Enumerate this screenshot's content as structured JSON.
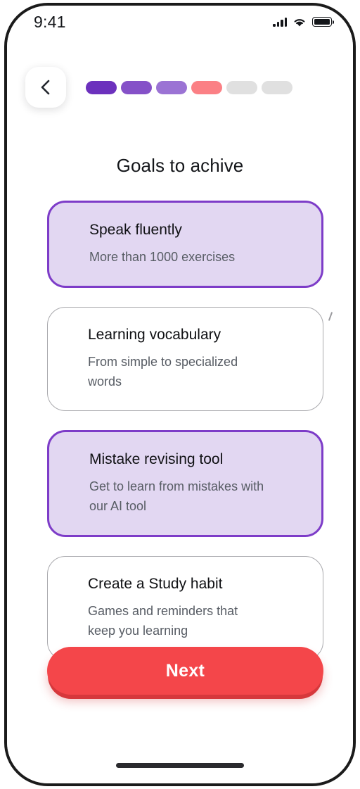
{
  "status_bar": {
    "time": "9:41",
    "icons": {
      "signal": "signal-bars-icon",
      "wifi": "wifi-icon",
      "battery": "battery-icon"
    }
  },
  "header": {
    "back_icon": "chevron-left-icon",
    "progress": {
      "total_steps": 6,
      "current_step": 4,
      "segments": [
        {
          "state": "complete",
          "color": "#6c31bd"
        },
        {
          "state": "complete",
          "color": "#8551c8"
        },
        {
          "state": "complete",
          "color": "#9b73d4"
        },
        {
          "state": "current",
          "color": "#fb8085"
        },
        {
          "state": "upcoming",
          "color": "#e0e0e0"
        },
        {
          "state": "upcoming",
          "color": "#e0e0e0"
        }
      ]
    }
  },
  "main": {
    "title": "Goals to achive",
    "goals": [
      {
        "title": "Speak fluently",
        "description": "More than 1000 exercises",
        "selected": true
      },
      {
        "title": "Learning vocabulary",
        "description": "From simple to specialized words",
        "selected": false
      },
      {
        "title": "Mistake revising tool",
        "description": "Get to learn from mistakes with our AI tool",
        "selected": true
      },
      {
        "title": "Create a Study habit",
        "description": "Games and reminders that keep you learning",
        "selected": false
      }
    ]
  },
  "footer": {
    "next_label": "Next"
  },
  "colors": {
    "accent_purple": "#7d3cc8",
    "card_selected_fill": "#e2d7f2",
    "card_border_unselected": "#a9a9ad",
    "primary_red": "#f4464a",
    "red_shadow": "#d6383c",
    "title_text": "#14161a",
    "body_text": "#575c64"
  }
}
